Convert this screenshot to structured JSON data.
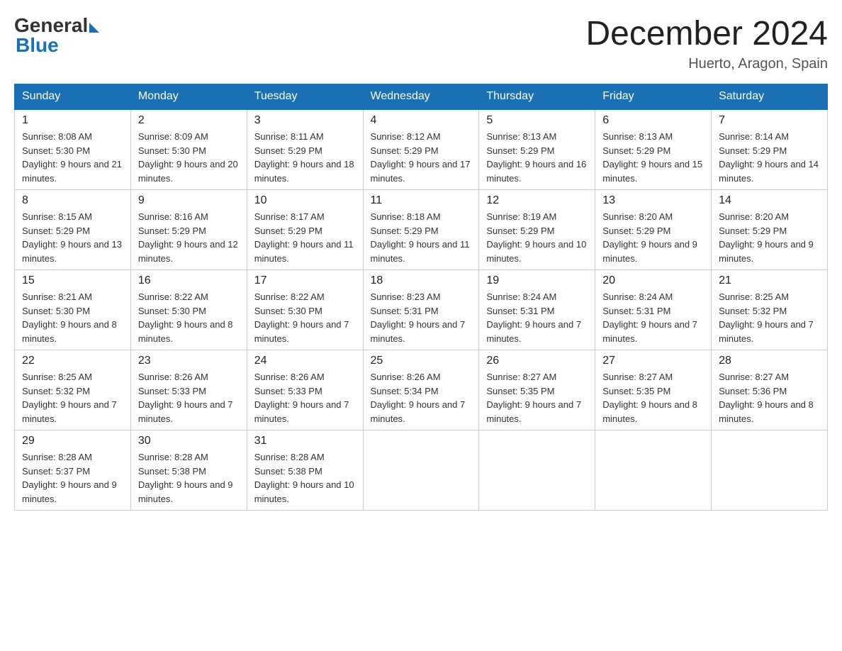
{
  "header": {
    "logo_general": "General",
    "logo_blue": "Blue",
    "month_title": "December 2024",
    "location": "Huerto, Aragon, Spain"
  },
  "days_of_week": [
    "Sunday",
    "Monday",
    "Tuesday",
    "Wednesday",
    "Thursday",
    "Friday",
    "Saturday"
  ],
  "weeks": [
    [
      {
        "day": "1",
        "sunrise": "Sunrise: 8:08 AM",
        "sunset": "Sunset: 5:30 PM",
        "daylight": "Daylight: 9 hours and 21 minutes."
      },
      {
        "day": "2",
        "sunrise": "Sunrise: 8:09 AM",
        "sunset": "Sunset: 5:30 PM",
        "daylight": "Daylight: 9 hours and 20 minutes."
      },
      {
        "day": "3",
        "sunrise": "Sunrise: 8:11 AM",
        "sunset": "Sunset: 5:29 PM",
        "daylight": "Daylight: 9 hours and 18 minutes."
      },
      {
        "day": "4",
        "sunrise": "Sunrise: 8:12 AM",
        "sunset": "Sunset: 5:29 PM",
        "daylight": "Daylight: 9 hours and 17 minutes."
      },
      {
        "day": "5",
        "sunrise": "Sunrise: 8:13 AM",
        "sunset": "Sunset: 5:29 PM",
        "daylight": "Daylight: 9 hours and 16 minutes."
      },
      {
        "day": "6",
        "sunrise": "Sunrise: 8:13 AM",
        "sunset": "Sunset: 5:29 PM",
        "daylight": "Daylight: 9 hours and 15 minutes."
      },
      {
        "day": "7",
        "sunrise": "Sunrise: 8:14 AM",
        "sunset": "Sunset: 5:29 PM",
        "daylight": "Daylight: 9 hours and 14 minutes."
      }
    ],
    [
      {
        "day": "8",
        "sunrise": "Sunrise: 8:15 AM",
        "sunset": "Sunset: 5:29 PM",
        "daylight": "Daylight: 9 hours and 13 minutes."
      },
      {
        "day": "9",
        "sunrise": "Sunrise: 8:16 AM",
        "sunset": "Sunset: 5:29 PM",
        "daylight": "Daylight: 9 hours and 12 minutes."
      },
      {
        "day": "10",
        "sunrise": "Sunrise: 8:17 AM",
        "sunset": "Sunset: 5:29 PM",
        "daylight": "Daylight: 9 hours and 11 minutes."
      },
      {
        "day": "11",
        "sunrise": "Sunrise: 8:18 AM",
        "sunset": "Sunset: 5:29 PM",
        "daylight": "Daylight: 9 hours and 11 minutes."
      },
      {
        "day": "12",
        "sunrise": "Sunrise: 8:19 AM",
        "sunset": "Sunset: 5:29 PM",
        "daylight": "Daylight: 9 hours and 10 minutes."
      },
      {
        "day": "13",
        "sunrise": "Sunrise: 8:20 AM",
        "sunset": "Sunset: 5:29 PM",
        "daylight": "Daylight: 9 hours and 9 minutes."
      },
      {
        "day": "14",
        "sunrise": "Sunrise: 8:20 AM",
        "sunset": "Sunset: 5:29 PM",
        "daylight": "Daylight: 9 hours and 9 minutes."
      }
    ],
    [
      {
        "day": "15",
        "sunrise": "Sunrise: 8:21 AM",
        "sunset": "Sunset: 5:30 PM",
        "daylight": "Daylight: 9 hours and 8 minutes."
      },
      {
        "day": "16",
        "sunrise": "Sunrise: 8:22 AM",
        "sunset": "Sunset: 5:30 PM",
        "daylight": "Daylight: 9 hours and 8 minutes."
      },
      {
        "day": "17",
        "sunrise": "Sunrise: 8:22 AM",
        "sunset": "Sunset: 5:30 PM",
        "daylight": "Daylight: 9 hours and 7 minutes."
      },
      {
        "day": "18",
        "sunrise": "Sunrise: 8:23 AM",
        "sunset": "Sunset: 5:31 PM",
        "daylight": "Daylight: 9 hours and 7 minutes."
      },
      {
        "day": "19",
        "sunrise": "Sunrise: 8:24 AM",
        "sunset": "Sunset: 5:31 PM",
        "daylight": "Daylight: 9 hours and 7 minutes."
      },
      {
        "day": "20",
        "sunrise": "Sunrise: 8:24 AM",
        "sunset": "Sunset: 5:31 PM",
        "daylight": "Daylight: 9 hours and 7 minutes."
      },
      {
        "day": "21",
        "sunrise": "Sunrise: 8:25 AM",
        "sunset": "Sunset: 5:32 PM",
        "daylight": "Daylight: 9 hours and 7 minutes."
      }
    ],
    [
      {
        "day": "22",
        "sunrise": "Sunrise: 8:25 AM",
        "sunset": "Sunset: 5:32 PM",
        "daylight": "Daylight: 9 hours and 7 minutes."
      },
      {
        "day": "23",
        "sunrise": "Sunrise: 8:26 AM",
        "sunset": "Sunset: 5:33 PM",
        "daylight": "Daylight: 9 hours and 7 minutes."
      },
      {
        "day": "24",
        "sunrise": "Sunrise: 8:26 AM",
        "sunset": "Sunset: 5:33 PM",
        "daylight": "Daylight: 9 hours and 7 minutes."
      },
      {
        "day": "25",
        "sunrise": "Sunrise: 8:26 AM",
        "sunset": "Sunset: 5:34 PM",
        "daylight": "Daylight: 9 hours and 7 minutes."
      },
      {
        "day": "26",
        "sunrise": "Sunrise: 8:27 AM",
        "sunset": "Sunset: 5:35 PM",
        "daylight": "Daylight: 9 hours and 7 minutes."
      },
      {
        "day": "27",
        "sunrise": "Sunrise: 8:27 AM",
        "sunset": "Sunset: 5:35 PM",
        "daylight": "Daylight: 9 hours and 8 minutes."
      },
      {
        "day": "28",
        "sunrise": "Sunrise: 8:27 AM",
        "sunset": "Sunset: 5:36 PM",
        "daylight": "Daylight: 9 hours and 8 minutes."
      }
    ],
    [
      {
        "day": "29",
        "sunrise": "Sunrise: 8:28 AM",
        "sunset": "Sunset: 5:37 PM",
        "daylight": "Daylight: 9 hours and 9 minutes."
      },
      {
        "day": "30",
        "sunrise": "Sunrise: 8:28 AM",
        "sunset": "Sunset: 5:38 PM",
        "daylight": "Daylight: 9 hours and 9 minutes."
      },
      {
        "day": "31",
        "sunrise": "Sunrise: 8:28 AM",
        "sunset": "Sunset: 5:38 PM",
        "daylight": "Daylight: 9 hours and 10 minutes."
      },
      null,
      null,
      null,
      null
    ]
  ]
}
